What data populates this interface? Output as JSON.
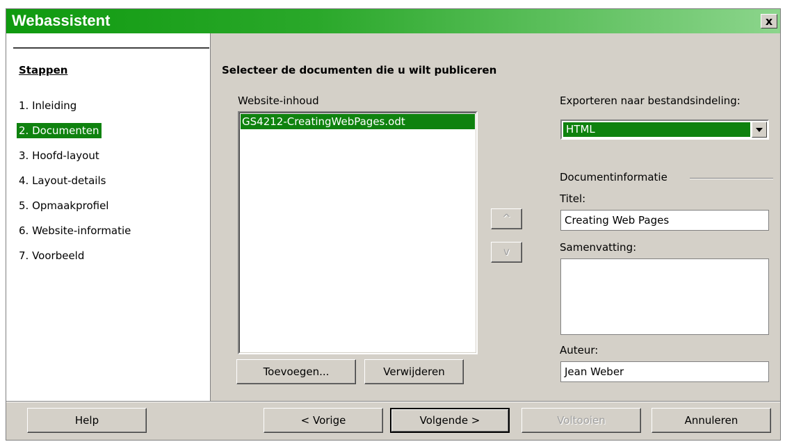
{
  "window": {
    "title": "Webassistent",
    "close_label": "x"
  },
  "steps": {
    "heading": "Stappen",
    "items": [
      {
        "label": "1. Inleiding"
      },
      {
        "label": "2. Documenten"
      },
      {
        "label": "3. Hoofd-layout"
      },
      {
        "label": "4. Layout-details"
      },
      {
        "label": "5. Opmaakprofiel"
      },
      {
        "label": "6. Website-informatie"
      },
      {
        "label": "7. Voorbeeld"
      }
    ]
  },
  "main": {
    "title": "Selecteer de documenten die u wilt publiceren",
    "content_label": "Website-inhoud",
    "content_items": [
      "GS4212-CreatingWebPages.odt"
    ],
    "add_button": "Toevoegen...",
    "remove_button": "Verwijderen",
    "up_button": "^",
    "down_button": "v",
    "export_label": "Exporteren naar bestandsindeling:",
    "export_value": "HTML",
    "docinfo_label": "Documentinformatie",
    "title_label": "Titel:",
    "title_value": "Creating Web Pages",
    "summary_label": "Samenvatting:",
    "summary_value": "",
    "author_label": "Auteur:",
    "author_value": "Jean Weber"
  },
  "footer": {
    "help": "Help",
    "previous": "< Vorige",
    "next": "Volgende >",
    "finish": "Voltooien",
    "cancel": "Annuleren"
  }
}
